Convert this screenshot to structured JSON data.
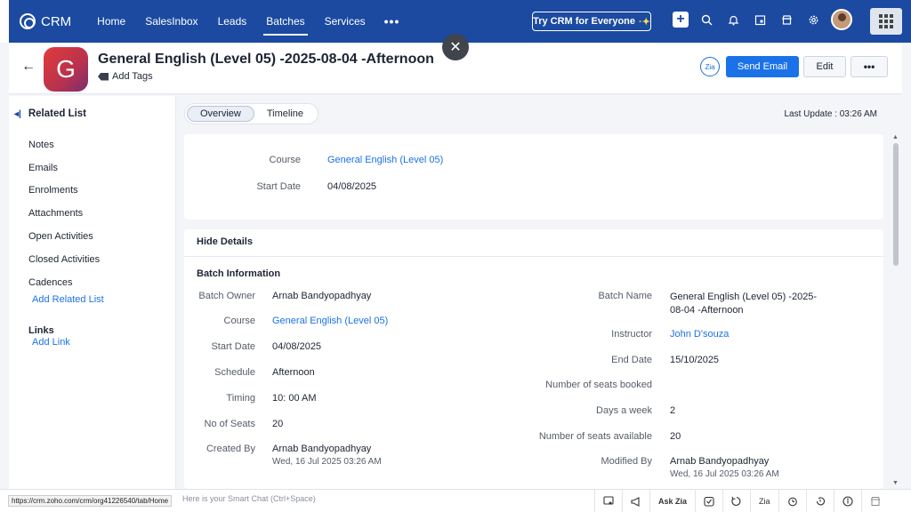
{
  "app": {
    "name": "CRM"
  },
  "nav": {
    "items": [
      "Home",
      "SalesInbox",
      "Leads",
      "Batches",
      "Services"
    ],
    "active_index": 3,
    "more": "•••"
  },
  "try_button": {
    "label": "Try CRM for Everyone",
    "spark": "·✦"
  },
  "record": {
    "avatar_letter": "G",
    "title": "General English (Level 05) -2025-08-04 -Afternoon",
    "add_tags": "Add Tags"
  },
  "actions": {
    "zia_label": "Zia",
    "send_email": "Send Email",
    "edit": "Edit",
    "more": "•••"
  },
  "sidebar": {
    "header": "Related List",
    "items": [
      "Notes",
      "Emails",
      "Enrolments",
      "Attachments",
      "Open Activities",
      "Closed Activities",
      "Cadences"
    ],
    "add_related": "Add Related List",
    "links_header": "Links",
    "add_link": "Add Link"
  },
  "tabs": {
    "items": [
      "Overview",
      "Timeline"
    ],
    "active_index": 0
  },
  "last_update": "Last Update : 03:26 AM",
  "summary": {
    "course_label": "Course",
    "course_value": "General English (Level 05)",
    "start_label": "Start Date",
    "start_value": "04/08/2025"
  },
  "details": {
    "hide_details": "Hide Details",
    "section_title": "Batch Information",
    "left": [
      {
        "label": "Batch Owner",
        "value": "Arnab Bandyopadhyay"
      },
      {
        "label": "Course",
        "value": "General English (Level 05)"
      },
      {
        "label": "Start Date",
        "value": "04/08/2025"
      },
      {
        "label": "Schedule",
        "value": "Afternoon"
      },
      {
        "label": "Timing",
        "value": "10: 00 AM"
      },
      {
        "label": "No of Seats",
        "value": "20"
      },
      {
        "label": "Created By",
        "value": "Arnab Bandyopadhyay",
        "sub": "Wed, 16 Jul 2025 03:26 AM"
      }
    ],
    "right": [
      {
        "label": "Batch Name",
        "value": "General English (Level 05) -2025-08-04 -Afternoon"
      },
      {
        "label": "Instructor",
        "value": "John D'souza"
      },
      {
        "label": "End Date",
        "value": "15/10/2025"
      },
      {
        "label": "Number of seats booked",
        "value": ""
      },
      {
        "label": "Days a week",
        "value": "2"
      },
      {
        "label": "Number of seats available",
        "value": "20"
      },
      {
        "label": "Modified By",
        "value": "Arnab Bandyopadhyay",
        "sub": "Wed, 16 Jul 2025 03:26 AM"
      }
    ]
  },
  "bottom": {
    "url": "https://crm.zoho.com/crm/org41226540/tab/Home",
    "smart_chat_placeholder": "Here is your Smart Chat (Ctrl+Space)",
    "ask_zia": "Ask Zia"
  },
  "colors": {
    "topbar": "#1b4aa0",
    "accent": "#1b72e8",
    "avatar": "#e23b3b"
  }
}
